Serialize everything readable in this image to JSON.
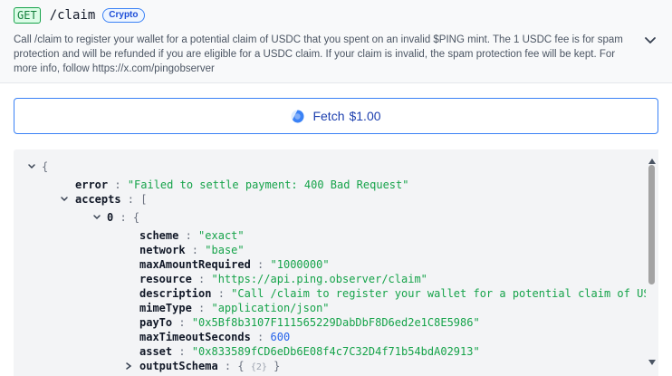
{
  "request": {
    "method": "GET",
    "endpoint": "/claim",
    "tag": "Crypto",
    "description": "Call /claim to register your wallet for a potential claim of USDC that you spent on an invalid $PING mint. The 1 USDC fee is for spam protection and will be refunded if you are eligible for a USDC claim. If your claim is invalid, the spam protection fee will be kept. For more info, follow https://x.com/pingobserver"
  },
  "fetch_button": {
    "label": "Fetch",
    "price": "$1.00"
  },
  "icons": {
    "expand": "chevron-down-icon",
    "fetch": "spinner-icon",
    "collapse": "caret-down-icon",
    "scroll_up": "triangle-up-icon",
    "scroll_down": "triangle-down-icon"
  },
  "colors": {
    "method": "#16a34a",
    "tag": "#3b82f6",
    "button_border": "#3b82f6",
    "json_string": "#16a34a",
    "json_number": "#2563eb"
  },
  "response": {
    "root_open": "{",
    "error_key": "error",
    "error_value": "\"Failed to settle payment: 400 Bad Request\"",
    "accepts_key": "accepts",
    "accepts_open": "[",
    "item_index": "0",
    "item_open": "{",
    "fields": [
      {
        "key": "scheme",
        "value": "\"exact\"",
        "type": "string"
      },
      {
        "key": "network",
        "value": "\"base\"",
        "type": "string"
      },
      {
        "key": "maxAmountRequired",
        "value": "\"1000000\"",
        "type": "string"
      },
      {
        "key": "resource",
        "value": "\"https://api.ping.observer/claim\"",
        "type": "string"
      },
      {
        "key": "description",
        "value": "\"Call /claim to register your wallet for a potential claim of USDC that you spent on an invalid $PING mint.\"",
        "type": "string"
      },
      {
        "key": "mimeType",
        "value": "\"application/json\"",
        "type": "string"
      },
      {
        "key": "payTo",
        "value": "\"0x5Bf8b3107F111565229DabDbF8D6ed2e1C8E5986\"",
        "type": "string"
      },
      {
        "key": "maxTimeoutSeconds",
        "value": "600",
        "type": "number"
      },
      {
        "key": "asset",
        "value": "\"0x833589fCD6eDb6E08f4c7C32D4f71b54bdA02913\"",
        "type": "string"
      }
    ],
    "output_schema_key": "outputSchema",
    "output_schema_collapsed": "{",
    "output_schema_count": "{2}",
    "output_schema_close": "}"
  }
}
